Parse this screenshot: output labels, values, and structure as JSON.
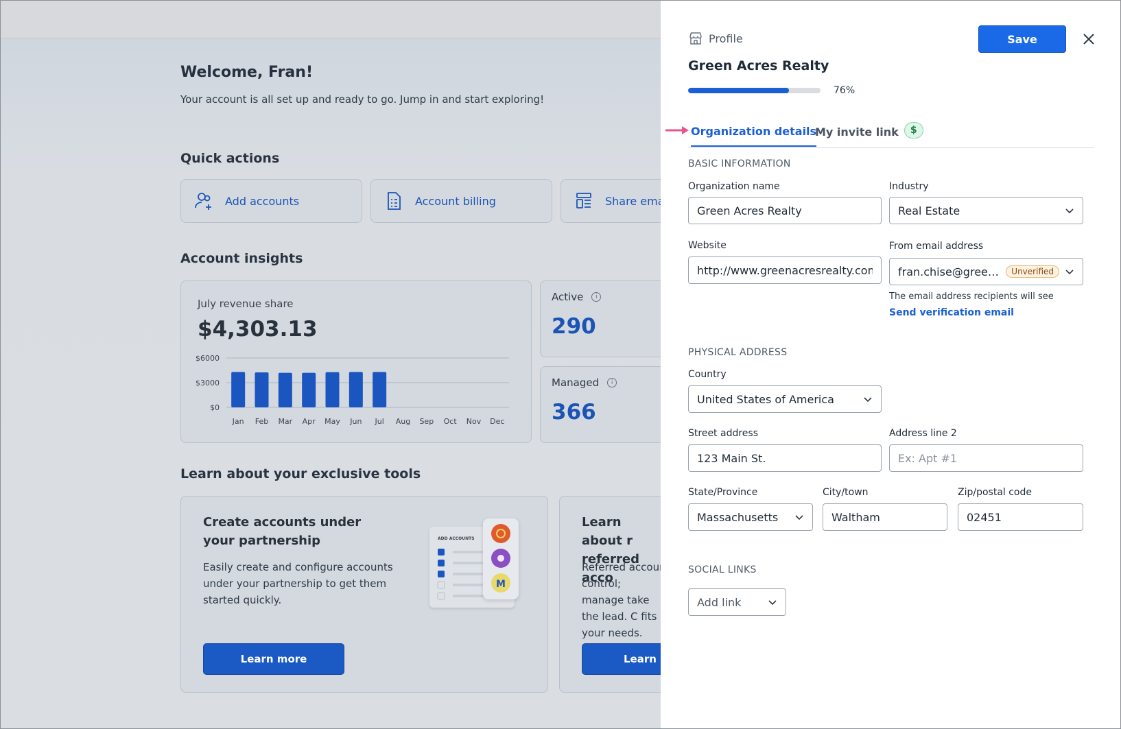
{
  "dashboard": {
    "welcome_title": "Welcome, Fran!",
    "welcome_sub": "Your account is all set up and ready to go. Jump in and start exploring!",
    "quick_actions_title": "Quick actions",
    "quick_actions": [
      {
        "label": "Add accounts",
        "icon": "add-user-icon"
      },
      {
        "label": "Account billing",
        "icon": "document-icon"
      },
      {
        "label": "Share emai",
        "icon": "layout-icon"
      }
    ],
    "insights_title": "Account insights",
    "revenue": {
      "label": "July revenue share",
      "value": "$4,303.13"
    },
    "active": {
      "label": "Active",
      "value": "290"
    },
    "managed": {
      "label": "Managed",
      "value": "366"
    },
    "learn_title": "Learn about your exclusive tools",
    "tools": [
      {
        "title": "Create accounts under your partnership",
        "desc": "Easily create and configure accounts under your partnership to get them started quickly.",
        "button": "Learn more"
      },
      {
        "title": "Learn about r referred acco",
        "desc": "Referred accour control; manage take the lead. C fits your needs.",
        "button": "Learn r"
      }
    ],
    "mini_illustration_label": "ADD ACCOUNTS"
  },
  "chart_data": {
    "type": "bar",
    "categories": [
      "Jan",
      "Feb",
      "Mar",
      "Apr",
      "May",
      "Jun",
      "Jul",
      "Aug",
      "Sep",
      "Oct",
      "Nov",
      "Dec"
    ],
    "values": [
      4300,
      4250,
      4200,
      4200,
      4280,
      4300,
      4303.13,
      null,
      null,
      null,
      null,
      null
    ],
    "yticks": [
      "$6000",
      "$3000",
      "$0"
    ],
    "ylim": [
      0,
      6000
    ],
    "title": "",
    "xlabel": "",
    "ylabel": "",
    "bar_color": "#1b55c0"
  },
  "panel": {
    "header_label": "Profile",
    "save_label": "Save",
    "org_title": "Green Acres Realty",
    "progress": 76,
    "progress_text": "76%",
    "tabs": [
      {
        "label": "Organization details",
        "active": true
      },
      {
        "label": "My invite link",
        "badge": "$"
      }
    ],
    "basic_info": {
      "section": "BASIC INFORMATION",
      "org_name_label": "Organization name",
      "org_name_value": "Green Acres Realty",
      "industry_label": "Industry",
      "industry_value": "Real Estate",
      "website_label": "Website",
      "website_value": "http://www.greenacresrealty.com",
      "from_email_label": "From email address",
      "from_email_value": "fran.chise@greenac...",
      "unverified_badge": "Unverified",
      "email_help": "The email address recipients will see",
      "verify_link": "Send verification email"
    },
    "physical_address": {
      "section": "PHYSICAL ADDRESS",
      "country_label": "Country",
      "country_value": "United States of America",
      "street_label": "Street address",
      "street_value": "123 Main St.",
      "line2_label": "Address line 2",
      "line2_placeholder": "Ex: Apt #1",
      "state_label": "State/Province",
      "state_value": "Massachusetts",
      "city_label": "City/town",
      "city_value": "Waltham",
      "zip_label": "Zip/postal code",
      "zip_value": "02451"
    },
    "social_links": {
      "section": "SOCIAL LINKS",
      "add_link_label": "Add link"
    },
    "colors": {
      "primary": "#1a6ae8",
      "arrow": "#e8548f",
      "badge_green": "#1f7a47"
    }
  }
}
